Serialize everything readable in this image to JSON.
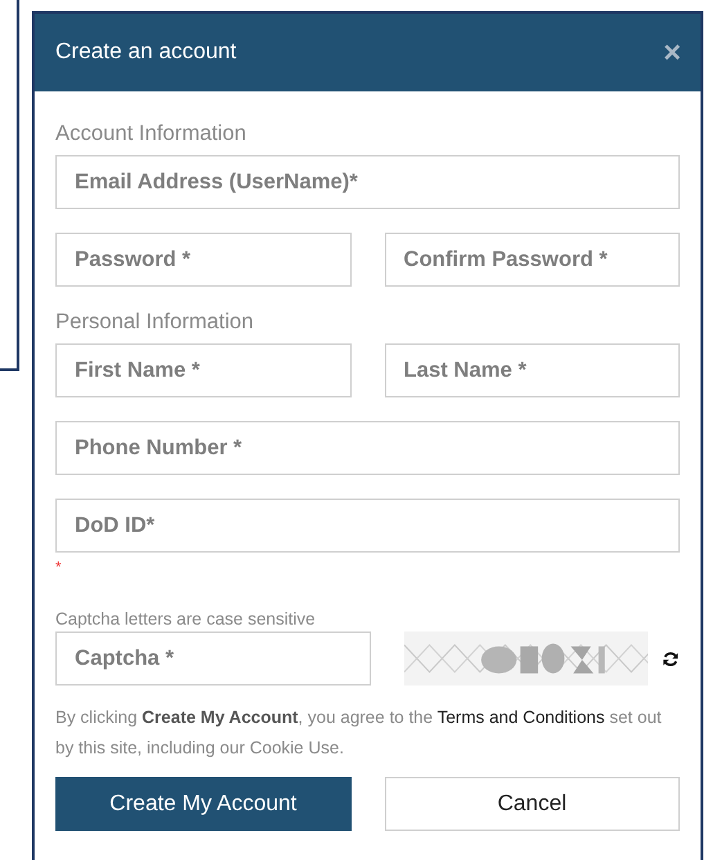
{
  "dialog": {
    "title": "Create an account",
    "close": "×"
  },
  "sections": [
    {
      "heading": "Account Information",
      "rows": [
        [
          {
            "placeholder": "Email Address (UserName)*"
          }
        ],
        [
          {
            "placeholder": "Password *"
          },
          {
            "placeholder": "Confirm Password *"
          }
        ]
      ]
    },
    {
      "heading": "Personal Information",
      "rows": [
        [
          {
            "placeholder": "First Name *"
          },
          {
            "placeholder": "Last Name *"
          }
        ],
        [
          {
            "placeholder": "Phone Number *"
          }
        ],
        [
          {
            "placeholder": "DoD ID*"
          }
        ]
      ]
    }
  ],
  "required_mark": "*",
  "captcha": {
    "hint": "Captcha letters are case sensitive",
    "placeholder": "Captcha *"
  },
  "notice": {
    "text": "By clicking **Create My Account**, you agree to the",
    "link": "Terms and Conditions",
    "after": "set out by this site, including our Cookie Use."
  },
  "buttons": [
    {
      "label": "Create My Account",
      "kind": "primary"
    },
    {
      "label": "Cancel",
      "kind": "secondary"
    }
  ]
}
